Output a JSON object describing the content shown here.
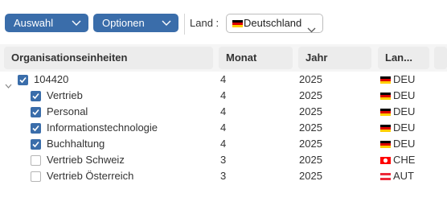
{
  "toolbar": {
    "auswahl_label": "Auswahl",
    "optionen_label": "Optionen",
    "land_label": "Land :",
    "land_value": "Deutschland"
  },
  "table": {
    "headers": [
      "Organisationseinheiten",
      "Monat",
      "Jahr",
      "Lan..."
    ],
    "rows": [
      {
        "name": "104420",
        "monat": "4",
        "jahr": "2025",
        "land": "DEU",
        "checked": true,
        "level": 0,
        "flag": "de"
      },
      {
        "name": "Vertrieb",
        "monat": "4",
        "jahr": "2025",
        "land": "DEU",
        "checked": true,
        "level": 1,
        "flag": "de"
      },
      {
        "name": "Personal",
        "monat": "4",
        "jahr": "2025",
        "land": "DEU",
        "checked": true,
        "level": 1,
        "flag": "de"
      },
      {
        "name": "Informationstechnologie",
        "monat": "4",
        "jahr": "2025",
        "land": "DEU",
        "checked": true,
        "level": 1,
        "flag": "de"
      },
      {
        "name": "Buchhaltung",
        "monat": "4",
        "jahr": "2025",
        "land": "DEU",
        "checked": true,
        "level": 1,
        "flag": "de"
      },
      {
        "name": "Vertrieb Schweiz",
        "monat": "3",
        "jahr": "2025",
        "land": "CHE",
        "checked": false,
        "level": 1,
        "flag": "ch"
      },
      {
        "name": "Vertrieb Österreich",
        "monat": "3",
        "jahr": "2025",
        "land": "AUT",
        "checked": false,
        "level": 1,
        "flag": "at"
      }
    ]
  },
  "colors": {
    "accent": "#3a6daa",
    "header_bg": "#ececec"
  },
  "icons": {
    "dropdown": "chevron-down-icon",
    "expand": "caret-down-icon",
    "check": "checkmark-icon"
  }
}
